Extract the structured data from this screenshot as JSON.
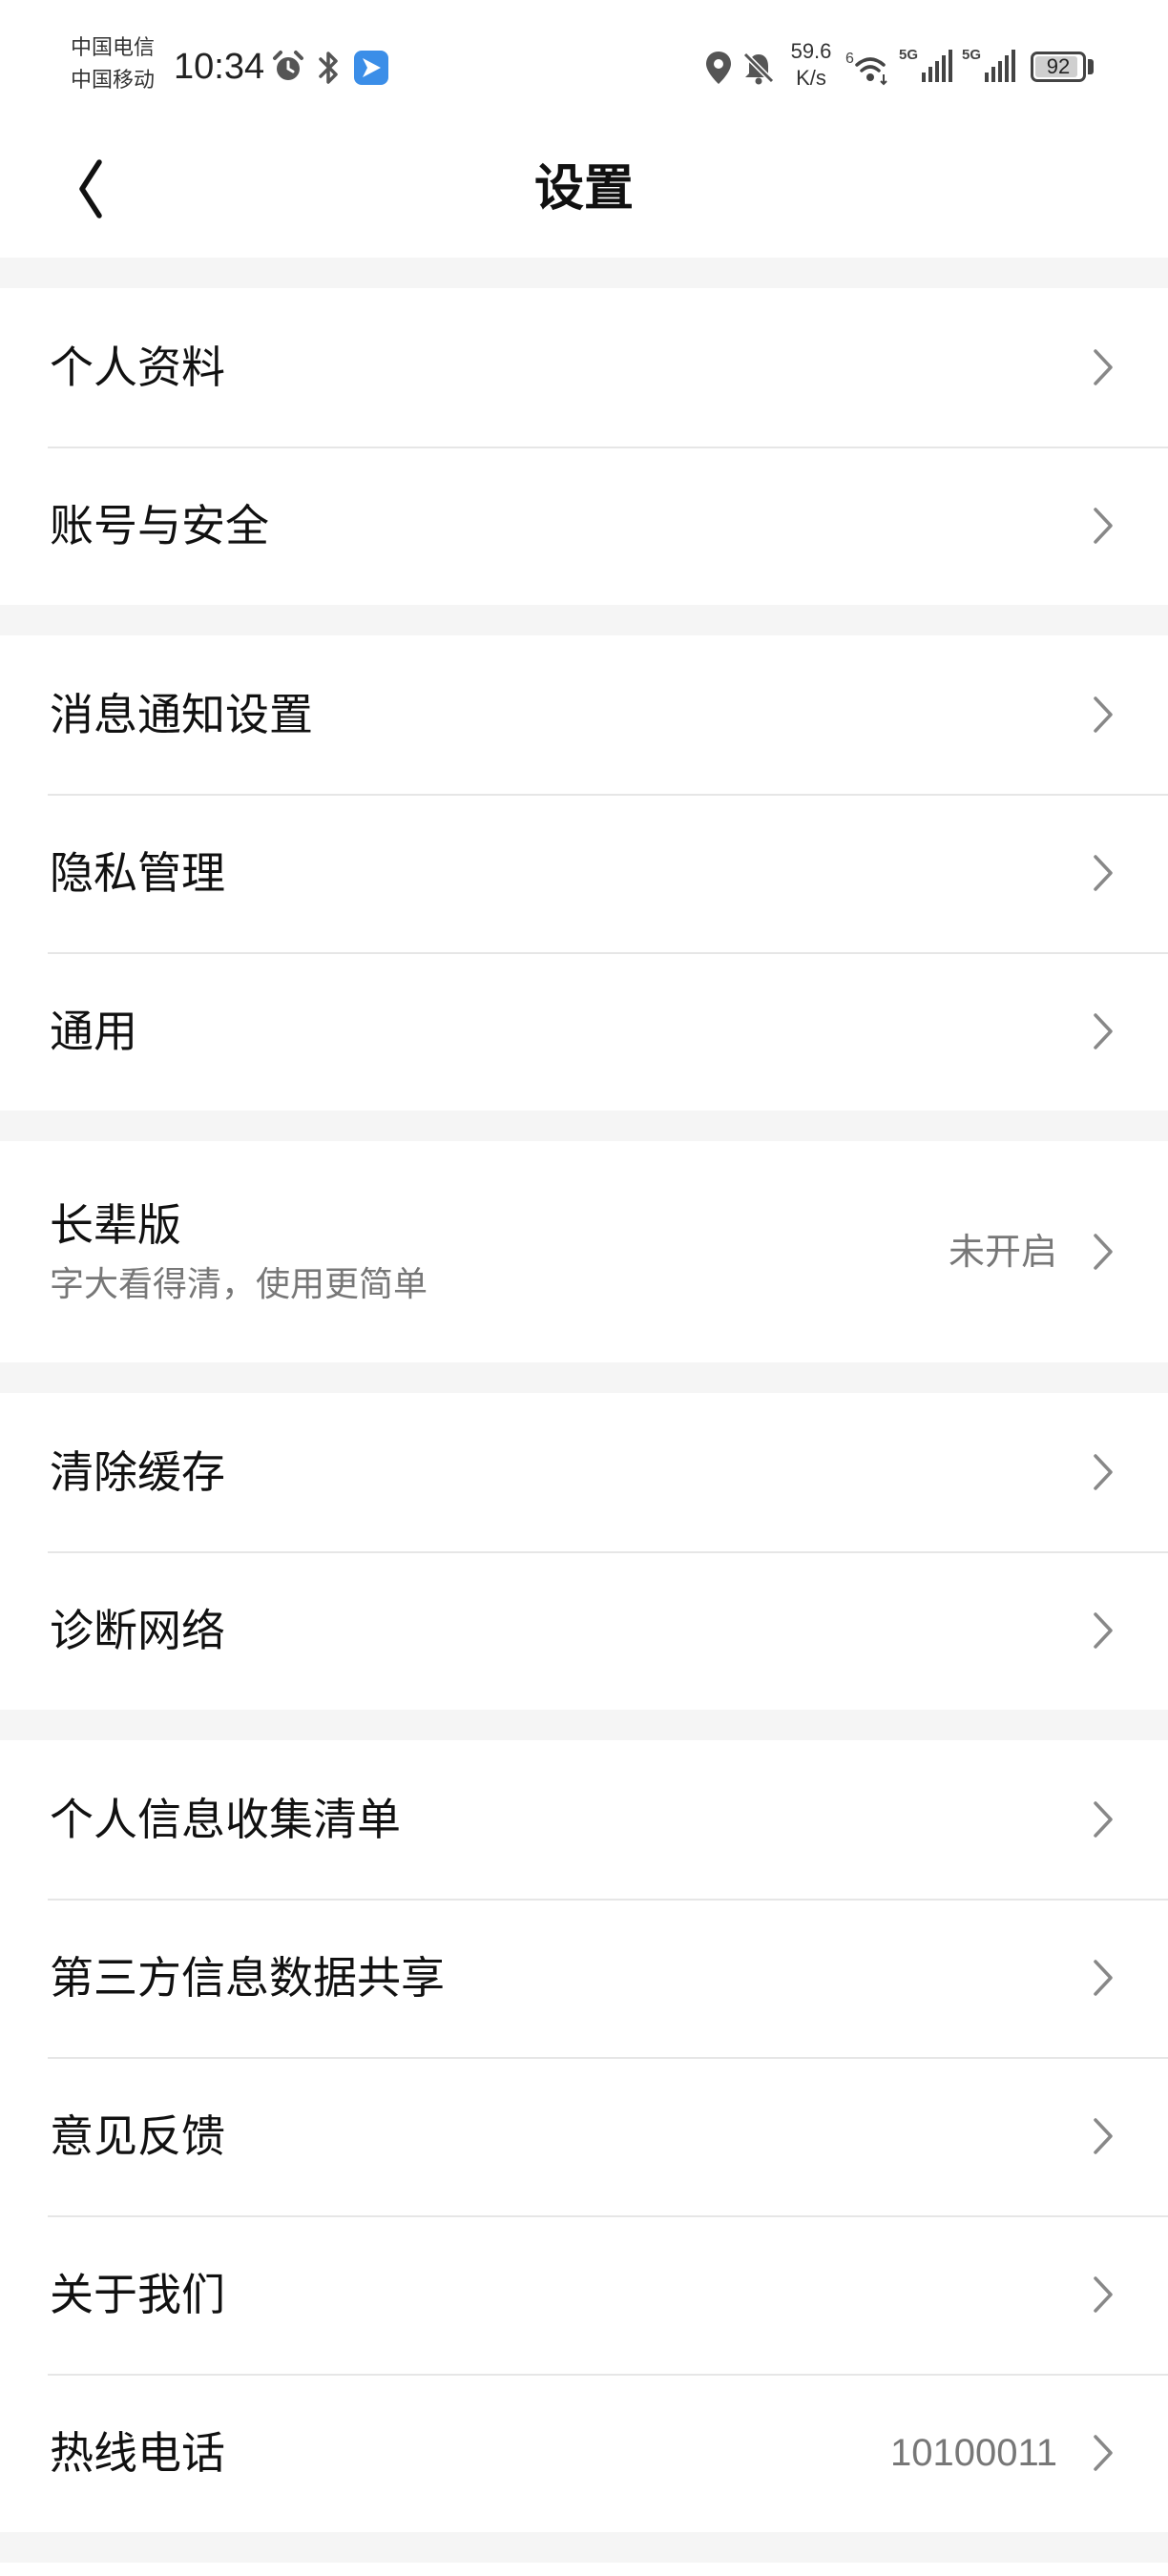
{
  "status_bar": {
    "carriers": [
      "中国电信",
      "中国移动"
    ],
    "time": "10:34",
    "net_speed_value": "59.6",
    "net_speed_unit": "K/s",
    "network_labels": [
      "6",
      "5G",
      "5G"
    ],
    "battery_percent": "92",
    "icons": [
      "alarm-icon",
      "bluetooth-icon",
      "app-notification-icon",
      "location-icon",
      "bell-muted-icon",
      "wifi-icon",
      "signal-icon"
    ]
  },
  "header": {
    "title": "设置",
    "back_icon": "chevron-left-icon"
  },
  "settings": {
    "groups": [
      {
        "items": [
          {
            "label": "个人资料"
          },
          {
            "label": "账号与安全"
          }
        ]
      },
      {
        "items": [
          {
            "label": "消息通知设置"
          },
          {
            "label": "隐私管理"
          },
          {
            "label": "通用"
          }
        ]
      },
      {
        "items": [
          {
            "label": "长辈版",
            "subtitle": "字大看得清，使用更简单",
            "value": "未开启"
          }
        ]
      },
      {
        "items": [
          {
            "label": "清除缓存"
          },
          {
            "label": "诊断网络"
          }
        ]
      },
      {
        "items": [
          {
            "label": "个人信息收集清单"
          },
          {
            "label": "第三方信息数据共享"
          },
          {
            "label": "意见反馈"
          },
          {
            "label": "关于我们"
          },
          {
            "label": "热线电话",
            "value": "10100011"
          }
        ]
      }
    ],
    "chevron_icon": "chevron-right-icon"
  },
  "colors": {
    "page_background": "#ffffff",
    "group_gap": "#f5f5f5",
    "divider": "#e6e6e6",
    "primary_text": "#111111",
    "secondary_text": "#777777",
    "chevron": "#888888"
  }
}
